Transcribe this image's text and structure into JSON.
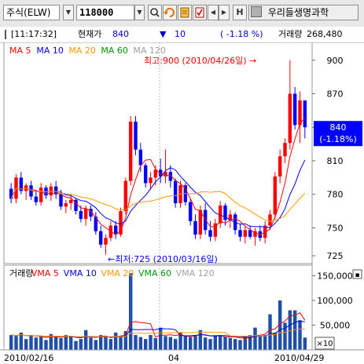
{
  "toolbar": {
    "market": "주식(ELW)",
    "code": "118000",
    "name": "우리들생명과학",
    "h_label": "H"
  },
  "info": {
    "time": "[11:17:32]",
    "price_label": "현재가",
    "price": "840",
    "change_arrow": "▼",
    "change": "10",
    "change_pct": "( -1.18  %)",
    "volume_label": "거래량",
    "volume": "268,480"
  },
  "chart_data": [
    {
      "type": "candlestick",
      "legend": [
        {
          "name": "MA 5",
          "color": "#ff0000"
        },
        {
          "name": "MA 10",
          "color": "#0000ff"
        },
        {
          "name": "MA 20",
          "color": "#ff9900"
        },
        {
          "name": "MA 60",
          "color": "#009900"
        },
        {
          "name": "MA 120",
          "color": "#a0a0a0"
        }
      ],
      "y_ticks": [
        "900",
        "870",
        "840",
        "810",
        "780",
        "750",
        "725"
      ],
      "ylim": [
        718,
        916
      ],
      "current_price": "840",
      "current_change": "(-1.18%)",
      "high_label": "최고:900 (2010/04/26일) →",
      "low_label": "←최저:725 (2010/03/16일)",
      "colors": {
        "up": "#ff0000",
        "down": "#0000ff",
        "ma5": "#ff0000",
        "ma10": "#0000ff",
        "ma20": "#ff9900"
      },
      "candles": [
        [
          785,
          790,
          772,
          776
        ],
        [
          776,
          798,
          772,
          795
        ],
        [
          795,
          800,
          780,
          783
        ],
        [
          783,
          790,
          775,
          788
        ],
        [
          788,
          792,
          775,
          778
        ],
        [
          778,
          784,
          770,
          773
        ],
        [
          773,
          790,
          770,
          786
        ],
        [
          786,
          788,
          776,
          779
        ],
        [
          779,
          790,
          774,
          787
        ],
        [
          787,
          792,
          776,
          780
        ],
        [
          780,
          784,
          766,
          769
        ],
        [
          769,
          775,
          763,
          772
        ],
        [
          772,
          780,
          766,
          775
        ],
        [
          775,
          776,
          762,
          765
        ],
        [
          765,
          770,
          755,
          758
        ],
        [
          758,
          770,
          752,
          767
        ],
        [
          767,
          770,
          756,
          760
        ],
        [
          760,
          764,
          744,
          747
        ],
        [
          747,
          752,
          732,
          735
        ],
        [
          735,
          744,
          726,
          741
        ],
        [
          741,
          756,
          738,
          752
        ],
        [
          752,
          756,
          740,
          744
        ],
        [
          744,
          768,
          742,
          765
        ],
        [
          765,
          795,
          762,
          792
        ],
        [
          792,
          850,
          788,
          845
        ],
        [
          845,
          850,
          815,
          820
        ],
        [
          820,
          826,
          800,
          806
        ],
        [
          806,
          808,
          786,
          790
        ],
        [
          790,
          800,
          784,
          795
        ],
        [
          795,
          806,
          788,
          802
        ],
        [
          802,
          812,
          790,
          796
        ],
        [
          796,
          820,
          790,
          800
        ],
        [
          800,
          806,
          786,
          792
        ],
        [
          792,
          794,
          768,
          772
        ],
        [
          772,
          792,
          768,
          788
        ],
        [
          788,
          790,
          770,
          773
        ],
        [
          773,
          776,
          752,
          756
        ],
        [
          756,
          762,
          740,
          744
        ],
        [
          744,
          770,
          740,
          766
        ],
        [
          766,
          772,
          744,
          748
        ],
        [
          748,
          756,
          738,
          742
        ],
        [
          742,
          758,
          738,
          754
        ],
        [
          754,
          774,
          750,
          770
        ],
        [
          770,
          772,
          752,
          757
        ],
        [
          757,
          766,
          750,
          762
        ],
        [
          762,
          764,
          744,
          748
        ],
        [
          748,
          754,
          738,
          742
        ],
        [
          742,
          752,
          736,
          748
        ],
        [
          748,
          752,
          740,
          742
        ],
        [
          742,
          750,
          734,
          747
        ],
        [
          747,
          752,
          738,
          741
        ],
        [
          741,
          756,
          736,
          752
        ],
        [
          752,
          766,
          748,
          762
        ],
        [
          762,
          800,
          758,
          796
        ],
        [
          796,
          820,
          790,
          814
        ],
        [
          814,
          830,
          808,
          826
        ],
        [
          826,
          900,
          820,
          870
        ],
        [
          870,
          876,
          838,
          842
        ],
        [
          842,
          872,
          826,
          864
        ],
        [
          864,
          856,
          830,
          840
        ]
      ],
      "x_labels": [
        "2010/02/16",
        "04",
        "2010/04/29"
      ]
    },
    {
      "type": "bar",
      "legend": [
        {
          "name": "거래량",
          "color": "#000000"
        },
        {
          "name": "VMA 5",
          "color": "#ff0000"
        },
        {
          "name": "VMA 10",
          "color": "#0000ff"
        },
        {
          "name": "VMA 20",
          "color": "#ff9900"
        },
        {
          "name": "VMA 60",
          "color": "#009900"
        },
        {
          "name": "VMA 120",
          "color": "#a0a0a0"
        }
      ],
      "y_ticks": [
        "150,000",
        "100,000",
        "50,000"
      ],
      "ylim": [
        0,
        165000
      ],
      "multiplier": "×10",
      "values": [
        30000,
        28000,
        35000,
        22000,
        30000,
        25000,
        28000,
        20000,
        32000,
        26000,
        24000,
        30000,
        28000,
        18000,
        22000,
        40000,
        25000,
        20000,
        30000,
        26000,
        22000,
        35000,
        28000,
        38000,
        155000,
        30000,
        26000,
        22000,
        30000,
        24000,
        45000,
        28000,
        26000,
        22000,
        35000,
        28000,
        26000,
        30000,
        40000,
        25000,
        22000,
        28000,
        30000,
        26000,
        24000,
        22000,
        20000,
        26000,
        30000,
        45000,
        28000,
        30000,
        72000,
        35000,
        100000,
        55000,
        80000,
        80000,
        60000,
        25000
      ]
    }
  ]
}
